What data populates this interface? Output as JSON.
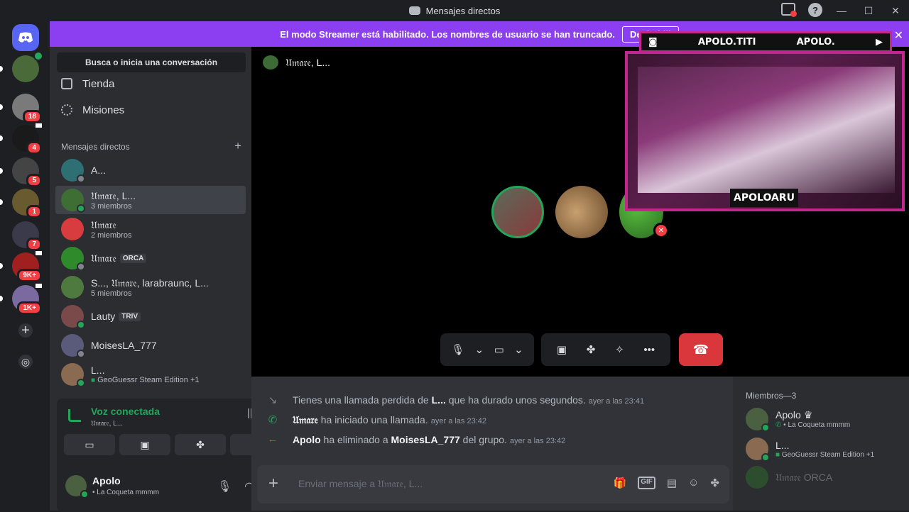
{
  "window": {
    "title": "Mensajes directos",
    "controls": [
      "—",
      "☐",
      "✕"
    ]
  },
  "banner": {
    "text": "El modo Streamer está habilitado. Los nombres de usuario se han truncado.",
    "button": "Deshabili"
  },
  "servers": [
    {
      "badge": ""
    },
    {
      "badge": "18"
    },
    {
      "badge": "4"
    },
    {
      "badge": "5"
    },
    {
      "badge": "1"
    },
    {
      "badge": "7"
    },
    {
      "badge": "9K+"
    },
    {
      "badge": "1K+"
    }
  ],
  "sidebar": {
    "search_placeholder": "Busca o inicia una conversación",
    "nav": [
      {
        "label": "Tienda"
      },
      {
        "label": "Misiones"
      }
    ],
    "dm_header": "Mensajes directos",
    "dms": [
      {
        "name": "A...",
        "sub": "",
        "tag": "",
        "color": "#2e6f73"
      },
      {
        "name": "𝔘𝔪𝔞𝔯𝔢, L...",
        "sub": "3 miembros",
        "tag": "",
        "color": "#3f6e35"
      },
      {
        "name": "𝔘𝔪𝔞𝔯𝔢",
        "sub": "2 miembros",
        "tag": "",
        "color": "#d83c3e"
      },
      {
        "name": "𝔘𝔪𝔞𝔯𝔢",
        "sub": "",
        "tag": "ORCA",
        "color": "#2f8a2b"
      },
      {
        "name": "S..., 𝔘𝔪𝔞𝔯𝔢, larabraunc, L...",
        "sub": "5 miembros",
        "tag": "",
        "color": "#4f7a3f"
      },
      {
        "name": "Lauty",
        "sub": "",
        "tag": "TRIV",
        "color": "#7a4a4a"
      },
      {
        "name": "MoisesLA_777",
        "sub": "",
        "tag": "",
        "color": "#5a5a7a"
      },
      {
        "name": "L...",
        "sub": "GeoGuessr Steam Edition +1",
        "tag": "",
        "color": "#8a6a50"
      }
    ]
  },
  "voice": {
    "title": "Voz conectada",
    "sub": "𝔘𝔪𝔞𝔯𝔢, L...",
    "user_name": "Apolo",
    "user_status": "• La Coqueta mmmm"
  },
  "call": {
    "header": "𝔘𝔪𝔞𝔯𝔢, L..."
  },
  "overlay": {
    "left_handle": "APOLO.TITI",
    "right_handle": "APOLO.",
    "name": "APOLOARU"
  },
  "chat": {
    "messages": [
      {
        "pre": "Tienes una llamada perdida de ",
        "bold": "L...",
        "post": " que ha durado unos segundos.",
        "time": "ayer a las 23:41",
        "icon": "↘",
        "color": "#80848e"
      },
      {
        "pre": "",
        "bold": "𝔘𝔪𝔞𝔯𝔢",
        "post": " ha iniciado una llamada.",
        "time": "ayer a las 23:42",
        "icon": "✆",
        "color": "#23a55a"
      },
      {
        "pre": "",
        "bold": "Apolo",
        "post": " ha eliminado a ",
        "bold2": "MoisesLA_777",
        "post2": " del grupo.",
        "time": "ayer a las 23:42",
        "icon": "←",
        "color": "#f23f43"
      }
    ],
    "placeholder": "Enviar mensaje a 𝔘𝔪𝔞𝔯𝔢, L..."
  },
  "members": {
    "header": "Miembros—3",
    "list": [
      {
        "name": "Apolo ♛",
        "status": "• La Coqueta mmmm",
        "color": "#4a6040"
      },
      {
        "name": "L...",
        "status": "GeoGuessr Steam Edition +1",
        "color": "#8a6a50"
      },
      {
        "name": "𝔘𝔪𝔞𝔯𝔢 ORCA",
        "status": "",
        "color": "#2f8a2b"
      }
    ]
  }
}
